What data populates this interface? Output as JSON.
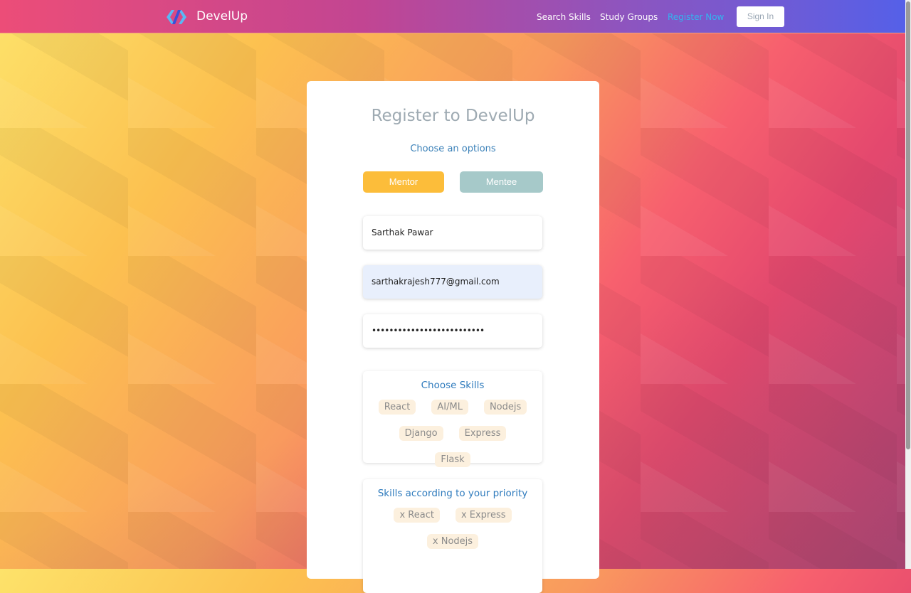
{
  "nav": {
    "brand": "DevelUp",
    "links": [
      "Search Skills",
      "Study Groups",
      "Register Now"
    ],
    "sign_in": "Sign In",
    "active_color": "#33b5f0"
  },
  "form": {
    "title": "Register to DevelUp",
    "subtitle": "Choose an options",
    "mentor": "Mentor",
    "mentee": "Mentee",
    "name_value": "Sarthak Pawar",
    "email_value": "sarthakrajesh777@gmail.com",
    "password_value": "••••••••••••••••••••••••••"
  },
  "skills": {
    "heading": "Choose Skills",
    "items": [
      "React",
      "AI/ML",
      "Nodejs",
      "Django",
      "Express",
      "Flask"
    ]
  },
  "priority": {
    "heading": "Skills according to your priority",
    "items": [
      "x React",
      "x Express",
      "x Nodejs"
    ]
  }
}
